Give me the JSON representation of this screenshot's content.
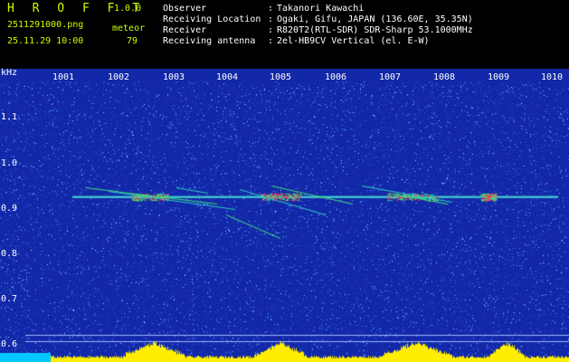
{
  "header": {
    "app_title": "H R O F F T",
    "version": "1.0.0",
    "file_name": "2511291000.png",
    "datetime": "25.11.29 10:00",
    "meteor_label": "meteor",
    "meteor_count": "79",
    "info": [
      {
        "label": "Observer",
        "value": "Takanori Kawachi"
      },
      {
        "label": "Receiving Location",
        "value": "Ogaki, Gifu, JAPAN (136.60E, 35.35N)"
      },
      {
        "label": "Receiver",
        "value": "R820T2(RTL-SDR) SDR-Sharp 53.1000MHz"
      },
      {
        "label": "Receiving antenna",
        "value": "2el-HB9CV Vertical (el. E-W)"
      }
    ],
    "colon": ":"
  },
  "chart_data": {
    "type": "heatmap",
    "ylabel": "kHz",
    "x_ticks": [
      "1001",
      "1002",
      "1003",
      "1004",
      "1005",
      "1006",
      "1007",
      "1008",
      "1009",
      "1010"
    ],
    "y_ticks": [
      "1.1",
      "1.0",
      "0.9",
      "0.8",
      "0.7",
      "0.6"
    ],
    "y_range": [
      0.58,
      1.2
    ],
    "carrier_khz": 0.925,
    "background_color": "#1228a8",
    "noise_color": "#4fa4ff",
    "echo_colors": [
      "#27e0c8",
      "#33ff55",
      "#ff2a55"
    ],
    "bottom_band_color": "#ffee00",
    "bottom_left_color": "#00c8ff"
  }
}
